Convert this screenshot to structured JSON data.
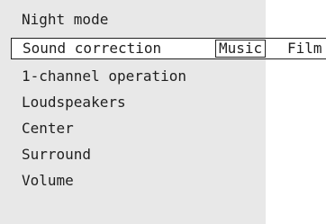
{
  "menu": {
    "items": [
      {
        "label": "Night mode"
      },
      {
        "label": "Sound correction"
      },
      {
        "label": "1-channel operation"
      },
      {
        "label": "Loudspeakers"
      },
      {
        "label": "Center"
      },
      {
        "label": "Surround"
      },
      {
        "label": "Volume"
      }
    ],
    "selected_index": 1,
    "sound_correction_options": {
      "selected": "Music",
      "items": [
        "Music",
        "Film"
      ]
    }
  },
  "colors": {
    "panel_background": "#e8e8e8",
    "page_background": "#ffffff",
    "text": "#1f1f1f",
    "border": "#222222"
  }
}
